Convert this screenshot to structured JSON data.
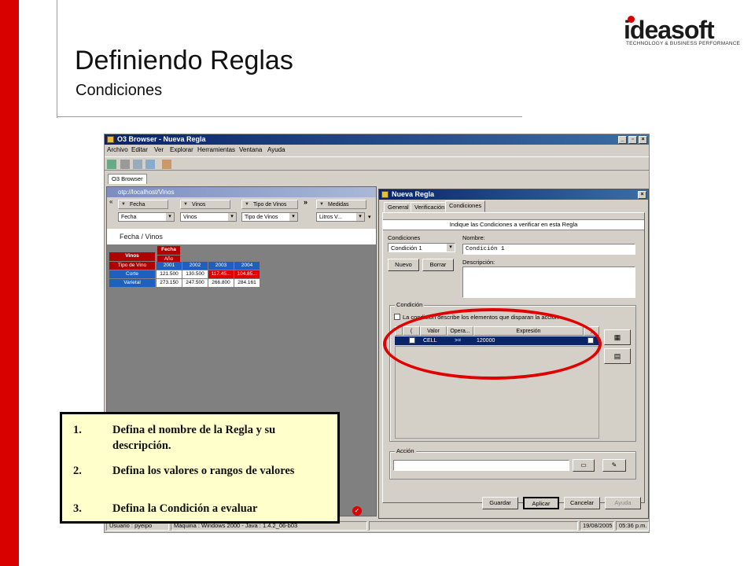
{
  "slide": {
    "title": "Definiendo Reglas",
    "subtitle": "Condiciones",
    "logo_text": "ideasoft",
    "logo_tagline": "TECHNOLOGY & BUSINESS PERFORMANCE",
    "brand_color": "#d90000"
  },
  "app": {
    "title": "O3 Browser - Nueva Regla",
    "menu": [
      "Archivo",
      "Editar",
      "Ver",
      "Explorar",
      "Herramientas",
      "Ventana",
      "Ayuda"
    ],
    "tab": "O3 Browser"
  },
  "left_panel": {
    "title": "otp://localhost/Vinos",
    "dimensions": [
      {
        "label": "Fecha",
        "value": "Fecha"
      },
      {
        "label": "Vinos",
        "value": "Vinos"
      },
      {
        "label": "Tipo de Vinos",
        "value": "Tipo de Vinos"
      },
      {
        "label": "Medidas",
        "value": "Litros V..."
      }
    ],
    "pivot_label": "Fecha / Vinos",
    "pivot": {
      "top_header": "Fecha",
      "sub_header": "Año",
      "row_header": "Vinos",
      "row_subheader": "Tipo de Vino",
      "years": [
        "2001",
        "2002",
        "2003",
        "2004"
      ],
      "rows": [
        {
          "label": "Corte",
          "values": [
            "121.500",
            "130.500",
            "117.45...",
            "104.85..."
          ]
        },
        {
          "label": "Varietal",
          "values": [
            "273.150",
            "247.500",
            "266.800",
            "284.161"
          ]
        }
      ]
    }
  },
  "rule_dialog": {
    "title": "Nueva Regla",
    "tabs": [
      "General",
      "Verificación",
      "Condiciones"
    ],
    "active_tab": "Condiciones",
    "header": "Indique las Condiciones a verificar en esta Regla",
    "conditions_label": "Condiciones",
    "conditions_value": "Condición 1",
    "name_label": "Nombre:",
    "name_value": "Condición 1",
    "description_label": "Descripción:",
    "new_button": "Nuevo",
    "delete_button": "Borrar",
    "condition_group": "Condición",
    "checkbox_label": "La condición describe los elementos que disparan la acción",
    "grid_headers": [
      "(",
      "Valor",
      "Opera...",
      "Expresión",
      ")"
    ],
    "grid_row": {
      "valor": "CELL",
      "operador": ">=",
      "expresion": "120000"
    },
    "action_group": "Acción",
    "buttons": [
      "Guardar",
      "Aplicar",
      "Cancelar",
      "Ayuda"
    ]
  },
  "statusbar": {
    "user": "Usuario : pyeipo",
    "machine": "Máquina : Windows 2000 - Java : 1.4.2_06-b03",
    "date": "19/08/2005",
    "time": "05:36 p.m."
  },
  "instructions": [
    {
      "num": "1.",
      "text": "Defina el nombre de la Regla y su descripción."
    },
    {
      "num": "2.",
      "text": "Defina los valores o rangos de valores"
    },
    {
      "num": "3.",
      "text": "Defina la Condición a evaluar"
    }
  ]
}
